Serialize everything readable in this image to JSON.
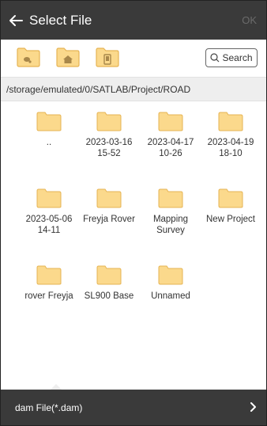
{
  "header": {
    "title": "Select File",
    "ok_label": "OK",
    "back_icon": "arrow-left-icon"
  },
  "toolbar": {
    "icons": [
      "location-folder-icon",
      "home-folder-icon",
      "device-folder-icon"
    ],
    "search_label": "Search",
    "search_icon": "search-icon"
  },
  "path": "/storage/emulated/0/SATLAB/Project/ROAD",
  "files": [
    {
      "label": ".."
    },
    {
      "label": "2023-03-16\n15-52"
    },
    {
      "label": "2023-04-17\n10-26"
    },
    {
      "label": "2023-04-19\n18-10"
    },
    {
      "label": "2023-05-06\n14-11"
    },
    {
      "label": "Freyja Rover"
    },
    {
      "label": "Mapping\nSurvey"
    },
    {
      "label": "New Project"
    },
    {
      "label": "rover Freyja"
    },
    {
      "label": "SL900 Base"
    },
    {
      "label": "Unnamed"
    }
  ],
  "footer": {
    "filter_label": "dam File(*.dam)",
    "chevron_icon": "chevron-right-icon"
  },
  "colors": {
    "bar": "#3a3a3a",
    "folder": "#fbd98c",
    "folder_stroke": "#e6b454",
    "path_bg": "#eeeeee"
  }
}
